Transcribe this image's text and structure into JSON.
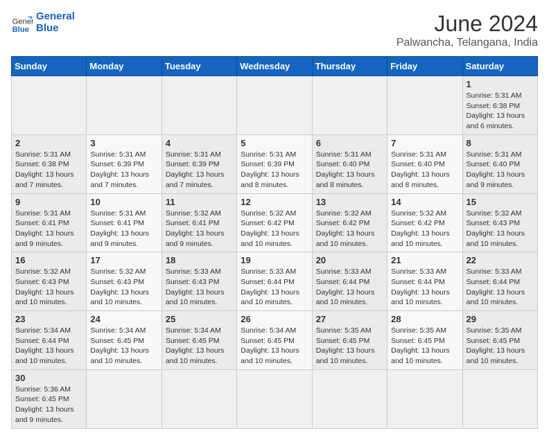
{
  "header": {
    "logo_general": "General",
    "logo_blue": "Blue",
    "month_year": "June 2024",
    "location": "Palwancha, Telangana, India"
  },
  "weekdays": [
    "Sunday",
    "Monday",
    "Tuesday",
    "Wednesday",
    "Thursday",
    "Friday",
    "Saturday"
  ],
  "weeks": [
    [
      {
        "day": "",
        "info": ""
      },
      {
        "day": "",
        "info": ""
      },
      {
        "day": "",
        "info": ""
      },
      {
        "day": "",
        "info": ""
      },
      {
        "day": "",
        "info": ""
      },
      {
        "day": "",
        "info": ""
      },
      {
        "day": "1",
        "info": "Sunrise: 5:31 AM\nSunset: 6:38 PM\nDaylight: 13 hours and 6 minutes."
      }
    ],
    [
      {
        "day": "2",
        "info": "Sunrise: 5:31 AM\nSunset: 6:38 PM\nDaylight: 13 hours and 7 minutes."
      },
      {
        "day": "3",
        "info": "Sunrise: 5:31 AM\nSunset: 6:39 PM\nDaylight: 13 hours and 7 minutes."
      },
      {
        "day": "4",
        "info": "Sunrise: 5:31 AM\nSunset: 6:39 PM\nDaylight: 13 hours and 7 minutes."
      },
      {
        "day": "5",
        "info": "Sunrise: 5:31 AM\nSunset: 6:39 PM\nDaylight: 13 hours and 8 minutes."
      },
      {
        "day": "6",
        "info": "Sunrise: 5:31 AM\nSunset: 6:40 PM\nDaylight: 13 hours and 8 minutes."
      },
      {
        "day": "7",
        "info": "Sunrise: 5:31 AM\nSunset: 6:40 PM\nDaylight: 13 hours and 8 minutes."
      },
      {
        "day": "8",
        "info": "Sunrise: 5:31 AM\nSunset: 6:40 PM\nDaylight: 13 hours and 9 minutes."
      }
    ],
    [
      {
        "day": "9",
        "info": "Sunrise: 5:31 AM\nSunset: 6:41 PM\nDaylight: 13 hours and 9 minutes."
      },
      {
        "day": "10",
        "info": "Sunrise: 5:31 AM\nSunset: 6:41 PM\nDaylight: 13 hours and 9 minutes."
      },
      {
        "day": "11",
        "info": "Sunrise: 5:32 AM\nSunset: 6:41 PM\nDaylight: 13 hours and 9 minutes."
      },
      {
        "day": "12",
        "info": "Sunrise: 5:32 AM\nSunset: 6:42 PM\nDaylight: 13 hours and 10 minutes."
      },
      {
        "day": "13",
        "info": "Sunrise: 5:32 AM\nSunset: 6:42 PM\nDaylight: 13 hours and 10 minutes."
      },
      {
        "day": "14",
        "info": "Sunrise: 5:32 AM\nSunset: 6:42 PM\nDaylight: 13 hours and 10 minutes."
      },
      {
        "day": "15",
        "info": "Sunrise: 5:32 AM\nSunset: 6:43 PM\nDaylight: 13 hours and 10 minutes."
      }
    ],
    [
      {
        "day": "16",
        "info": "Sunrise: 5:32 AM\nSunset: 6:43 PM\nDaylight: 13 hours and 10 minutes."
      },
      {
        "day": "17",
        "info": "Sunrise: 5:32 AM\nSunset: 6:43 PM\nDaylight: 13 hours and 10 minutes."
      },
      {
        "day": "18",
        "info": "Sunrise: 5:33 AM\nSunset: 6:43 PM\nDaylight: 13 hours and 10 minutes."
      },
      {
        "day": "19",
        "info": "Sunrise: 5:33 AM\nSunset: 6:44 PM\nDaylight: 13 hours and 10 minutes."
      },
      {
        "day": "20",
        "info": "Sunrise: 5:33 AM\nSunset: 6:44 PM\nDaylight: 13 hours and 10 minutes."
      },
      {
        "day": "21",
        "info": "Sunrise: 5:33 AM\nSunset: 6:44 PM\nDaylight: 13 hours and 10 minutes."
      },
      {
        "day": "22",
        "info": "Sunrise: 5:33 AM\nSunset: 6:44 PM\nDaylight: 13 hours and 10 minutes."
      }
    ],
    [
      {
        "day": "23",
        "info": "Sunrise: 5:34 AM\nSunset: 6:44 PM\nDaylight: 13 hours and 10 minutes."
      },
      {
        "day": "24",
        "info": "Sunrise: 5:34 AM\nSunset: 6:45 PM\nDaylight: 13 hours and 10 minutes."
      },
      {
        "day": "25",
        "info": "Sunrise: 5:34 AM\nSunset: 6:45 PM\nDaylight: 13 hours and 10 minutes."
      },
      {
        "day": "26",
        "info": "Sunrise: 5:34 AM\nSunset: 6:45 PM\nDaylight: 13 hours and 10 minutes."
      },
      {
        "day": "27",
        "info": "Sunrise: 5:35 AM\nSunset: 6:45 PM\nDaylight: 13 hours and 10 minutes."
      },
      {
        "day": "28",
        "info": "Sunrise: 5:35 AM\nSunset: 6:45 PM\nDaylight: 13 hours and 10 minutes."
      },
      {
        "day": "29",
        "info": "Sunrise: 5:35 AM\nSunset: 6:45 PM\nDaylight: 13 hours and 10 minutes."
      }
    ],
    [
      {
        "day": "30",
        "info": "Sunrise: 5:36 AM\nSunset: 6:45 PM\nDaylight: 13 hours and 9 minutes."
      },
      {
        "day": "",
        "info": ""
      },
      {
        "day": "",
        "info": ""
      },
      {
        "day": "",
        "info": ""
      },
      {
        "day": "",
        "info": ""
      },
      {
        "day": "",
        "info": ""
      },
      {
        "day": "",
        "info": ""
      }
    ]
  ]
}
